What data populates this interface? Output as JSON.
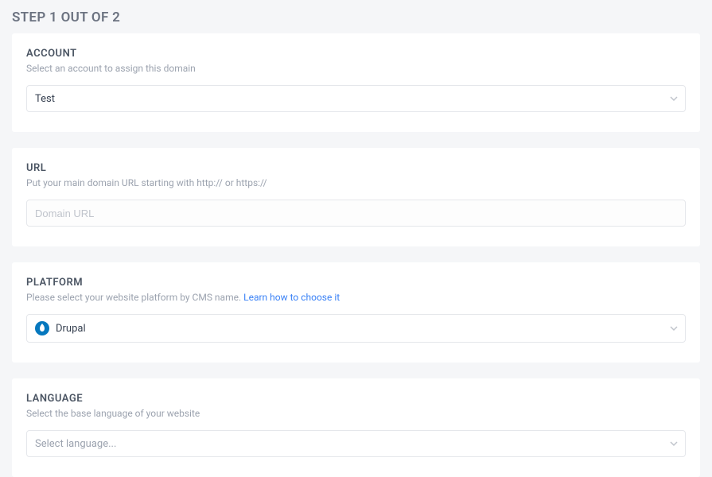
{
  "pageTitle": "STEP 1 OUT OF 2",
  "account": {
    "label": "ACCOUNT",
    "description": "Select an account to assign this domain",
    "value": "Test"
  },
  "url": {
    "label": "URL",
    "description": "Put your main domain URL starting with http:// or https://",
    "placeholder": "Domain URL"
  },
  "platform": {
    "label": "PLATFORM",
    "descriptionPrefix": "Please select your website platform by CMS name. ",
    "linkText": "Learn how to choose it",
    "value": "Drupal"
  },
  "language": {
    "label": "LANGUAGE",
    "description": "Select the base language of your website",
    "placeholder": "Select language..."
  }
}
